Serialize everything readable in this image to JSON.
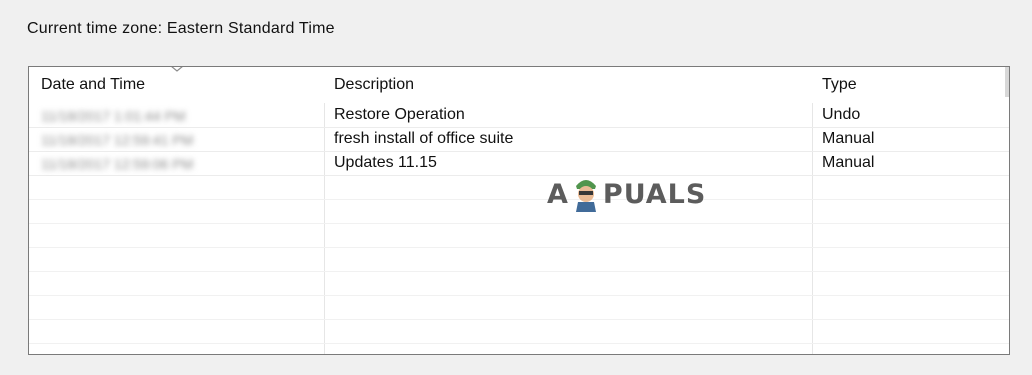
{
  "timezone_label": "Current time zone: Eastern Standard Time",
  "columns": {
    "date": "Date and Time",
    "description": "Description",
    "type": "Type"
  },
  "rows": [
    {
      "date": "11/18/2017 1:01:44 PM",
      "description": "Restore Operation",
      "type": "Undo"
    },
    {
      "date": "11/18/2017 12:59:41 PM",
      "description": "fresh install of office suite",
      "type": "Manual"
    },
    {
      "date": "11/18/2017 12:59:06 PM",
      "description": "Updates 11.15",
      "type": "Manual"
    }
  ],
  "watermark": {
    "left": "A",
    "right": "PUALS"
  },
  "icons": {
    "sort": "chevron-down-icon",
    "logo": "appuals-mascot-icon"
  }
}
